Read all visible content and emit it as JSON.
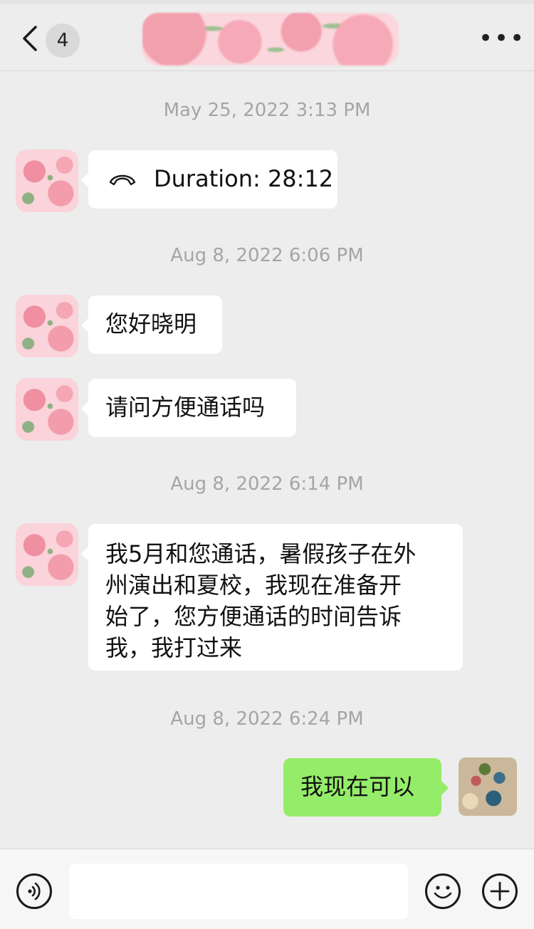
{
  "header": {
    "unread_count": "4",
    "more_label": "•••"
  },
  "messages": [
    {
      "type": "timestamp",
      "text": "May 25, 2022 3:13 PM"
    },
    {
      "type": "call",
      "side": "left",
      "text": "Duration: 28:12"
    },
    {
      "type": "timestamp",
      "text": "Aug 8, 2022 6:06 PM"
    },
    {
      "type": "text",
      "side": "left",
      "text": "您好晓明"
    },
    {
      "type": "text",
      "side": "left",
      "text": "请问方便通话吗"
    },
    {
      "type": "timestamp",
      "text": "Aug 8, 2022 6:14 PM"
    },
    {
      "type": "text",
      "side": "left",
      "lines": [
        "我5月和您通话，暑假孩子在外",
        "州演出和夏校，我现在准备开",
        "始了，您方便通话的时间告诉",
        "我，我打过来"
      ]
    },
    {
      "type": "timestamp",
      "text": "Aug 8, 2022 6:24 PM"
    },
    {
      "type": "text",
      "side": "right",
      "text": "我现在可以"
    }
  ],
  "input_bar": {
    "input_value": ""
  },
  "icons": [
    "back-chevron-icon",
    "more-icon",
    "phone-hangup-icon",
    "voice-icon",
    "emoji-icon",
    "plus-icon"
  ],
  "colors": {
    "background": "#ededed",
    "incoming_bubble": "#ffffff",
    "outgoing_bubble": "#95ec69",
    "timestamp_text": "#a5a5a5"
  }
}
